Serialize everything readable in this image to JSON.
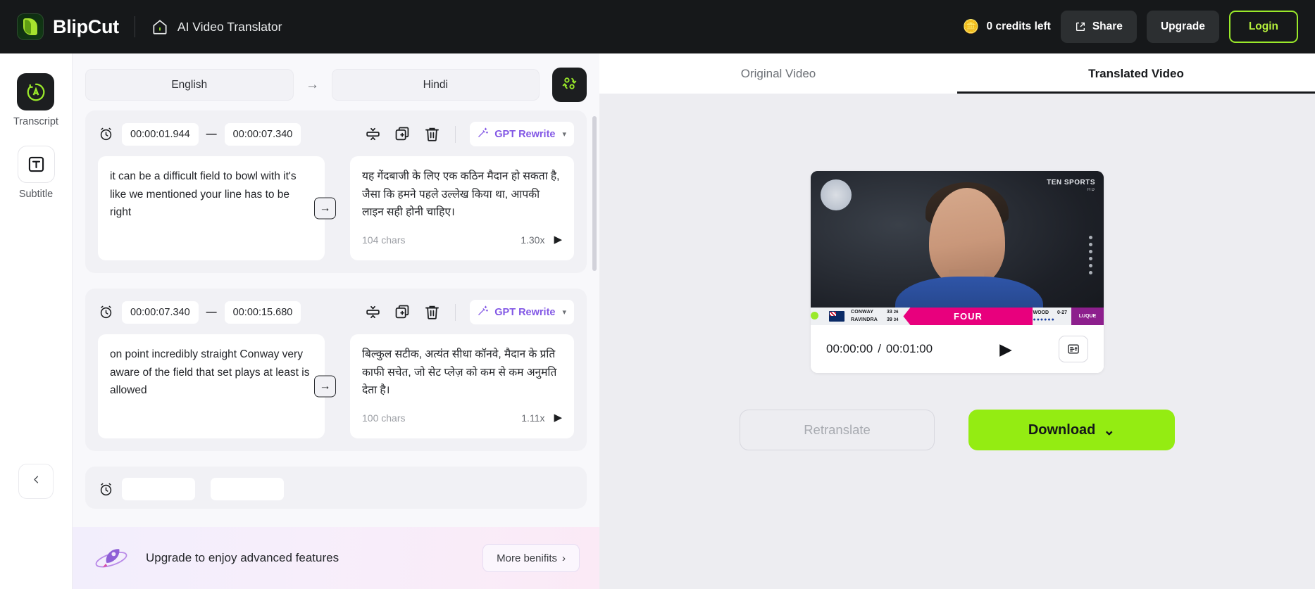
{
  "header": {
    "brand": "BlipCut",
    "home_icon": "home-icon",
    "page_title": "AI Video Translator",
    "credits_icon": "coins-icon",
    "credits_label": "0 credits left",
    "share_label": "Share",
    "share_icon": "external-link-icon",
    "upgrade_label": "Upgrade",
    "login_label": "Login",
    "accent_green": "#9ae92a",
    "bar_bg": "#16181a"
  },
  "rail": {
    "items": [
      {
        "label": "Transcript",
        "icon": "transcript-ai-icon",
        "active": true
      },
      {
        "label": "Subtitle",
        "icon": "subtitle-t-icon",
        "active": false
      }
    ],
    "collapse_icon": "chevron-left-icon"
  },
  "editor": {
    "source_language": "English",
    "target_language": "Hindi",
    "arrow_icon": "arrow-right-icon",
    "swap_icon": "swap-languages-icon",
    "segments": [
      {
        "start": "00:00:01.944",
        "end": "00:00:07.340",
        "dash": "—",
        "source_text": "it can be a difficult field to bowl with it's like we mentioned your line has to be right",
        "target_text": "यह गेंदबाजी के लिए एक कठिन मैदान हो सकता है, जैसा कि हमने पहले उल्लेख किया था, आपकी लाइन सही होनी चाहिए।",
        "chars": "104 chars",
        "speed": "1.30x",
        "rewrite_label": "GPT Rewrite"
      },
      {
        "start": "00:00:07.340",
        "end": "00:00:15.680",
        "dash": "—",
        "source_text": "on point incredibly straight Conway very aware of the field that set plays at least is allowed",
        "target_text": "बिल्कुल सटीक, अत्यंत सीधा कॉनवे, मैदान के प्रति काफी सचेत, जो सेट प्लेज़ को कम से कम अनुमति देता है।",
        "chars": "100 chars",
        "speed": "1.11x",
        "rewrite_label": "GPT Rewrite"
      }
    ],
    "tools": {
      "split_icon": "split-segment-icon",
      "duplicate_icon": "duplicate-icon",
      "delete_icon": "trash-icon",
      "magic_icon": "magic-wand-icon",
      "caret_icon": "chevron-down-icon",
      "clock_icon": "alarm-clock-icon",
      "translate_arrow_icon": "arrow-right-box-icon",
      "play_icon": "play-icon"
    },
    "banner": {
      "icon": "rocket-icon",
      "text": "Upgrade to enjoy advanced features",
      "cta": "More benifits",
      "cta_icon": "chevron-right-icon"
    }
  },
  "preview": {
    "tabs": [
      {
        "label": "Original Video",
        "active": false
      },
      {
        "label": "Translated Video",
        "active": true
      }
    ],
    "player": {
      "current_time": "00:00:00",
      "separator": "/",
      "duration": "00:01:00",
      "play_icon": "play-icon",
      "captions_icon": "captions-icon",
      "overlay": {
        "network": "TEN SPORTS",
        "network_sub": "HD",
        "batsman_1": "CONWAY",
        "batsman_1_runs": "33",
        "batsman_1_balls": "26",
        "batsman_2": "RAVINDRA",
        "batsman_2_runs": "39",
        "batsman_2_balls": "34",
        "event": "FOUR",
        "bowler": "WOOD",
        "bowler_figures": "0-27",
        "sponsor": "LUQUE"
      }
    },
    "actions": {
      "retranslate_label": "Retranslate",
      "download_label": "Download",
      "download_caret": "chevron-down-icon",
      "download_color": "#94ec12"
    }
  }
}
